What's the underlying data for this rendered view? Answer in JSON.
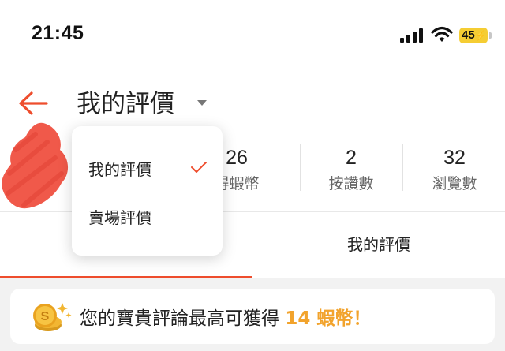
{
  "status_bar": {
    "time": "21:45",
    "battery": "45",
    "icons": [
      "cellular-signal-icon",
      "wifi-icon",
      "battery-charging-icon"
    ]
  },
  "header": {
    "title": "我的評價",
    "back_icon": "arrow-left-icon",
    "dropdown_icon": "caret-down-icon"
  },
  "stats": [
    {
      "value": "26",
      "label": "得蝦幣"
    },
    {
      "value": "2",
      "label": "按讚數"
    },
    {
      "value": "32",
      "label": "瀏覽數"
    }
  ],
  "tabs": [
    {
      "label": "",
      "active": true
    },
    {
      "label": "我的評價",
      "active": false
    }
  ],
  "promo": {
    "prefix": "您的寶貴評論最高可獲得 ",
    "highlight": "14 蝦幣！",
    "icon": "coins-icon"
  },
  "dropdown": {
    "items": [
      {
        "label": "我的評價",
        "selected": true
      },
      {
        "label": "賣場評價",
        "selected": false
      }
    ]
  },
  "colors": {
    "accent": "#ee4d2d",
    "highlight": "#f2a32c",
    "redaction": "#f0594a"
  }
}
